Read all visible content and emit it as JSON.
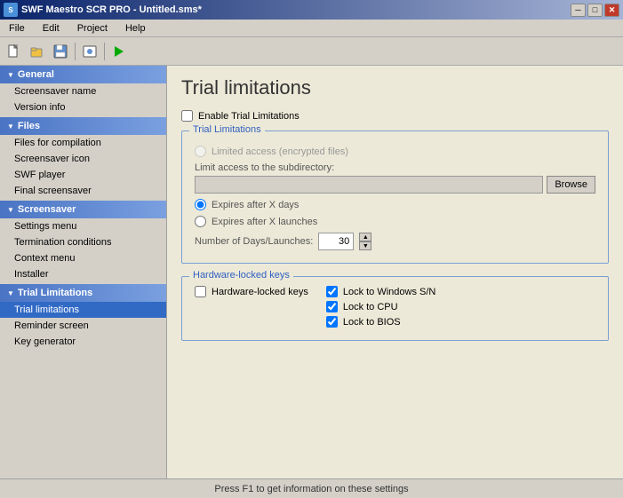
{
  "window": {
    "title": "SWF Maestro SCR PRO - Untitled.sms*",
    "title_icon": "S"
  },
  "menu": {
    "items": [
      "File",
      "Edit",
      "Project",
      "Help"
    ]
  },
  "toolbar": {
    "buttons": [
      "new",
      "open",
      "save",
      "divider",
      "preview",
      "divider",
      "play"
    ]
  },
  "sidebar": {
    "sections": [
      {
        "id": "general",
        "label": "General",
        "items": [
          "Screensaver name",
          "Version info"
        ]
      },
      {
        "id": "files",
        "label": "Files",
        "items": [
          "Files for compilation",
          "Screensaver icon",
          "SWF player",
          "Final screensaver"
        ]
      },
      {
        "id": "screensaver",
        "label": "Screensaver",
        "items": [
          "Settings menu",
          "Termination conditions",
          "Context menu",
          "Installer"
        ]
      },
      {
        "id": "trial-limitations",
        "label": "Trial Limitations",
        "items": [
          "Trial limitations",
          "Reminder screen",
          "Key generator"
        ]
      }
    ]
  },
  "content": {
    "page_title": "Trial limitations",
    "enable_label": "Enable Trial Limitations",
    "trial_group_title": "Trial Limitations",
    "limited_access_label": "Limited access (encrypted files)",
    "subdirectory_label": "Limit access to the subdirectory:",
    "subdirectory_placeholder": "",
    "browse_label": "Browse",
    "expires_days_label": "Expires after X days",
    "expires_launches_label": "Expires after X launches",
    "days_launches_label": "Number of Days/Launches:",
    "days_value": "30",
    "hardware_group_title": "Hardware-locked keys",
    "hardware_checkbox_label": "Hardware-locked keys",
    "lock_windows_label": "Lock to Windows S/N",
    "lock_cpu_label": "Lock to CPU",
    "lock_bios_label": "Lock to BIOS"
  },
  "status_bar": {
    "text": "Press F1 to get information on these settings"
  }
}
